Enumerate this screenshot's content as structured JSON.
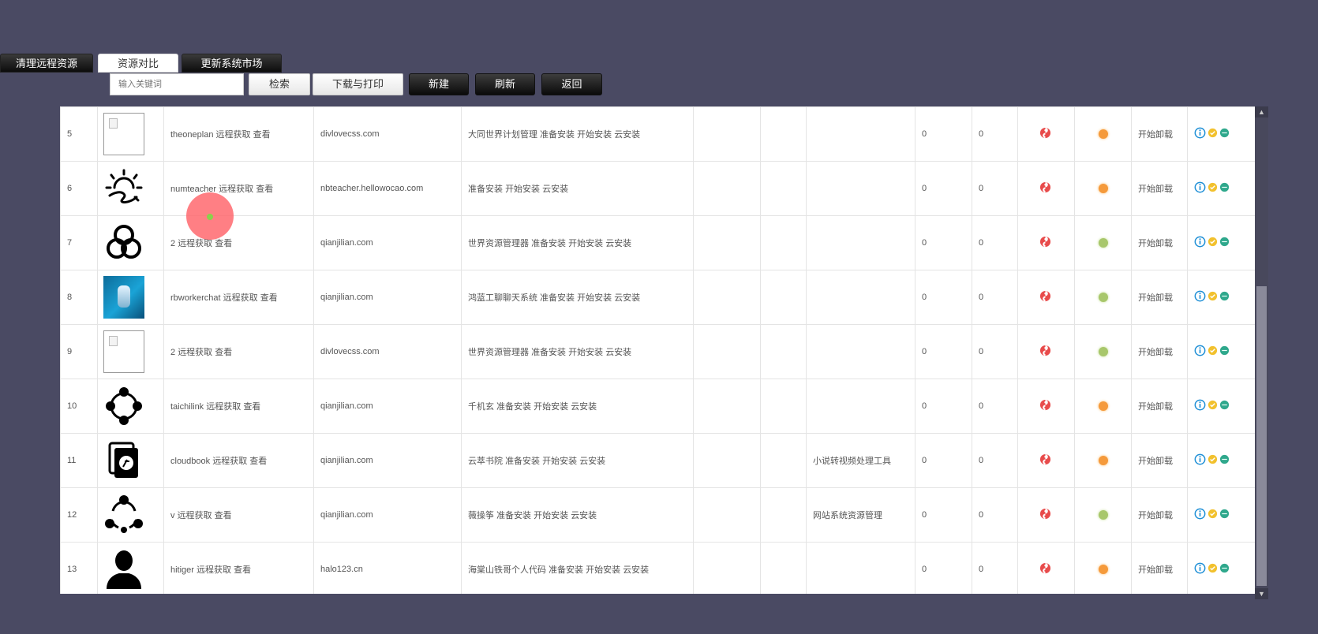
{
  "tabs": [
    {
      "label": "清理远程资源"
    },
    {
      "label": "资源对比"
    },
    {
      "label": "更新系统市场"
    }
  ],
  "toolbar": {
    "search_placeholder": "输入关键词",
    "search_label": "检索",
    "print_label": "下载与打印",
    "new_label": "新建",
    "refresh_label": "刷新",
    "back_label": "返回"
  },
  "table": {
    "rows": [
      {
        "num": "5",
        "thumb": "blank-image",
        "name": "theoneplan",
        "fetch": "远程获取",
        "view": "查看",
        "domain": "divlovecss.com",
        "title": "大同世界计划管理",
        "install1": "准备安装",
        "install2": "开始安装",
        "install3": "云安装",
        "extra": "",
        "count1": "0",
        "count2": "0",
        "dot_color": "orange",
        "uninstall": "开始卸载"
      },
      {
        "num": "6",
        "thumb": "sun-icon",
        "name": "numteacher",
        "fetch": "远程获取",
        "view": "查看",
        "domain": "nbteacher.hellowocao.com",
        "title": "",
        "install1": "准备安装",
        "install2": "开始安装",
        "install3": "云安装",
        "extra": "",
        "count1": "0",
        "count2": "0",
        "dot_color": "orange",
        "uninstall": "开始卸载"
      },
      {
        "num": "7",
        "thumb": "three-circles-icon",
        "name": "2",
        "fetch": "远程获取",
        "view": "查看",
        "domain": "qianjilian.com",
        "title": "世界资源管理器",
        "install1": "准备安装",
        "install2": "开始安装",
        "install3": "云安装",
        "extra": "",
        "count1": "0",
        "count2": "0",
        "dot_color": "green",
        "uninstall": "开始卸载"
      },
      {
        "num": "8",
        "thumb": "blue-photo",
        "name": "rbworkerchat",
        "fetch": "远程获取",
        "view": "查看",
        "domain": "qianjilian.com",
        "title": "鸿蓝工聊聊天系统",
        "install1": "准备安装",
        "install2": "开始安装",
        "install3": "云安装",
        "extra": "",
        "count1": "0",
        "count2": "0",
        "dot_color": "green",
        "uninstall": "开始卸载"
      },
      {
        "num": "9",
        "thumb": "blank-image",
        "name": "2",
        "fetch": "远程获取",
        "view": "查看",
        "domain": "divlovecss.com",
        "title": "世界资源管理器",
        "install1": "准备安装",
        "install2": "开始安装",
        "install3": "云安装",
        "extra": "",
        "count1": "0",
        "count2": "0",
        "dot_color": "green",
        "uninstall": "开始卸载"
      },
      {
        "num": "10",
        "thumb": "dot-ring-icon",
        "name": "taichilink",
        "fetch": "远程获取",
        "view": "查看",
        "domain": "qianjilian.com",
        "title": "千机玄",
        "install1": "准备安装",
        "install2": "开始安装",
        "install3": "云安装",
        "extra": "",
        "count1": "0",
        "count2": "0",
        "dot_color": "orange",
        "uninstall": "开始卸载"
      },
      {
        "num": "11",
        "thumb": "book-icon",
        "name": "cloudbook",
        "fetch": "远程获取",
        "view": "查看",
        "domain": "qianjilian.com",
        "title": "云萃书院",
        "install1": "准备安装",
        "install2": "开始安装",
        "install3": "云安装",
        "extra": "小说转视频处理工具",
        "count1": "0",
        "count2": "0",
        "dot_color": "orange",
        "uninstall": "开始卸载"
      },
      {
        "num": "12",
        "thumb": "share-circle-icon",
        "name": "v",
        "fetch": "远程获取",
        "view": "查看",
        "domain": "qianjilian.com",
        "title": "薇操筝",
        "install1": "准备安装",
        "install2": "开始安装",
        "install3": "云安装",
        "extra": "网站系统资源管理",
        "count1": "0",
        "count2": "0",
        "dot_color": "green",
        "uninstall": "开始卸载"
      },
      {
        "num": "13",
        "thumb": "person-icon",
        "name": "hitiger",
        "fetch": "远程获取",
        "view": "查看",
        "domain": "halo123.cn",
        "title": "海棠山铁哥个人代码",
        "install1": "准备安装",
        "install2": "开始安装",
        "install3": "云安装",
        "extra": "",
        "count1": "0",
        "count2": "0",
        "dot_color": "orange",
        "uninstall": "开始卸载"
      }
    ]
  },
  "colors": {
    "background": "#4a4a63",
    "orange_dot": "#f59a3b",
    "green_dot": "#a8c76b",
    "info_blue": "#1e8fd6",
    "check_yellow": "#f2c12e",
    "status_teal": "#2fa88c",
    "swirl_red": "#e84b4b"
  }
}
